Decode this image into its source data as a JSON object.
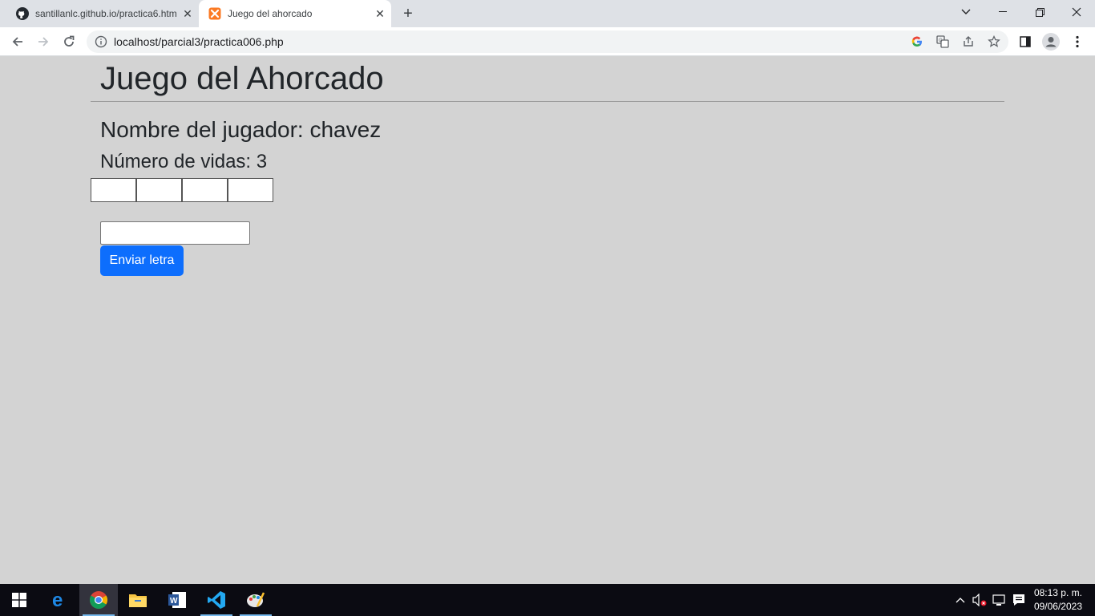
{
  "browser": {
    "tabs": [
      {
        "title": "santillanlc.github.io/practica6.html",
        "icon": "github-icon",
        "active": false
      },
      {
        "title": "Juego del ahorcado",
        "icon": "xampp-icon",
        "active": true
      }
    ],
    "address": "localhost/parcial3/practica006.php"
  },
  "page": {
    "heading": "Juego del Ahorcado",
    "player_text": "Nombre del jugador: chavez",
    "lives_text": "Número de vidas: 3",
    "letter_slots": [
      "",
      "",
      "",
      ""
    ],
    "letter_input": {
      "value": "",
      "placeholder": ""
    },
    "submit_label": "Enviar letra"
  },
  "taskbar": {
    "apps": [
      "start-icon",
      "edge-icon",
      "chrome-icon",
      "file-explorer-icon",
      "word-icon",
      "vscode-icon",
      "paint-icon"
    ],
    "active_app": "chrome-icon",
    "time": "08:13 p. m.",
    "date": "09/06/2023"
  },
  "colors": {
    "page_background": "#d3d3d3",
    "button": "#0d6efd",
    "taskbar": "#0b0b12"
  }
}
